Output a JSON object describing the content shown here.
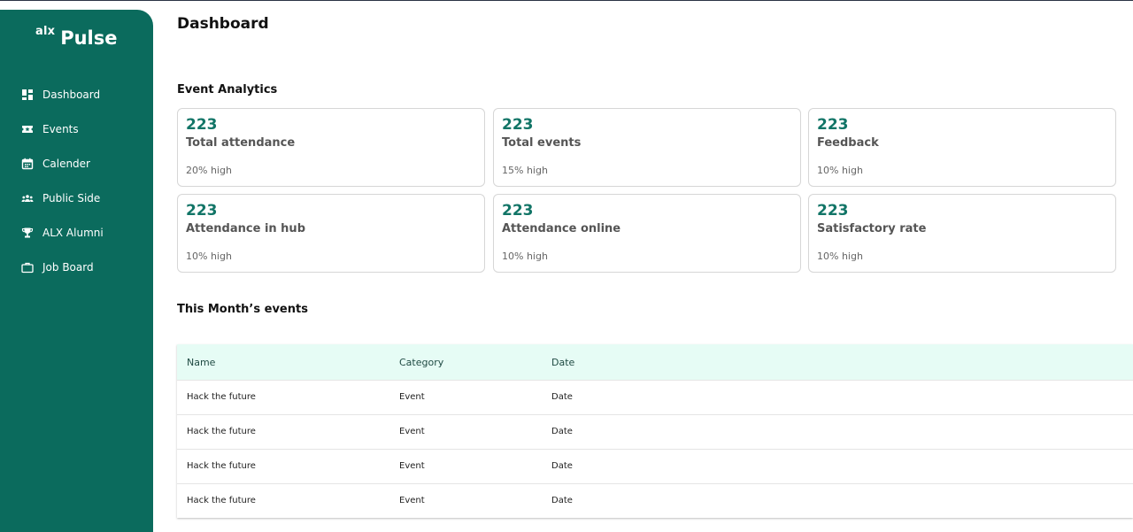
{
  "brand": {
    "prefix": "alx",
    "name": "Pulse"
  },
  "nav": [
    {
      "label": "Dashboard",
      "icon": "dashboard-icon"
    },
    {
      "label": "Events",
      "icon": "ticket-icon"
    },
    {
      "label": "Calender",
      "icon": "calendar-icon"
    },
    {
      "label": "Public Side",
      "icon": "people-icon"
    },
    {
      "label": "ALX Alumni",
      "icon": "trophy-icon"
    },
    {
      "label": "Job Board",
      "icon": "briefcase-icon"
    }
  ],
  "page": {
    "title": "Dashboard"
  },
  "analytics": {
    "title": "Event Analytics",
    "cards": [
      {
        "value": "223",
        "label": "Total attendance",
        "sub": "20% high"
      },
      {
        "value": "223",
        "label": "Total events",
        "sub": "15% high"
      },
      {
        "value": "223",
        "label": "Feedback",
        "sub": "10% high"
      },
      {
        "value": "223",
        "label": "Attendance in hub",
        "sub": "10% high"
      },
      {
        "value": "223",
        "label": "Attendance online",
        "sub": "10% high"
      },
      {
        "value": "223",
        "label": "Satisfactory rate",
        "sub": "10% high"
      }
    ]
  },
  "events": {
    "title": "This Month’s events",
    "columns": [
      "Name",
      "Category",
      "Date"
    ],
    "rows": [
      [
        "Hack the future",
        "Event",
        "Date"
      ],
      [
        "Hack the future",
        "Event",
        "Date"
      ],
      [
        "Hack the future",
        "Event",
        "Date"
      ],
      [
        "Hack the future",
        "Event",
        "Date"
      ]
    ]
  },
  "colors": {
    "sidebar": "#0b6b5d",
    "accent": "#127567",
    "table_header": "#e6fcf5"
  }
}
